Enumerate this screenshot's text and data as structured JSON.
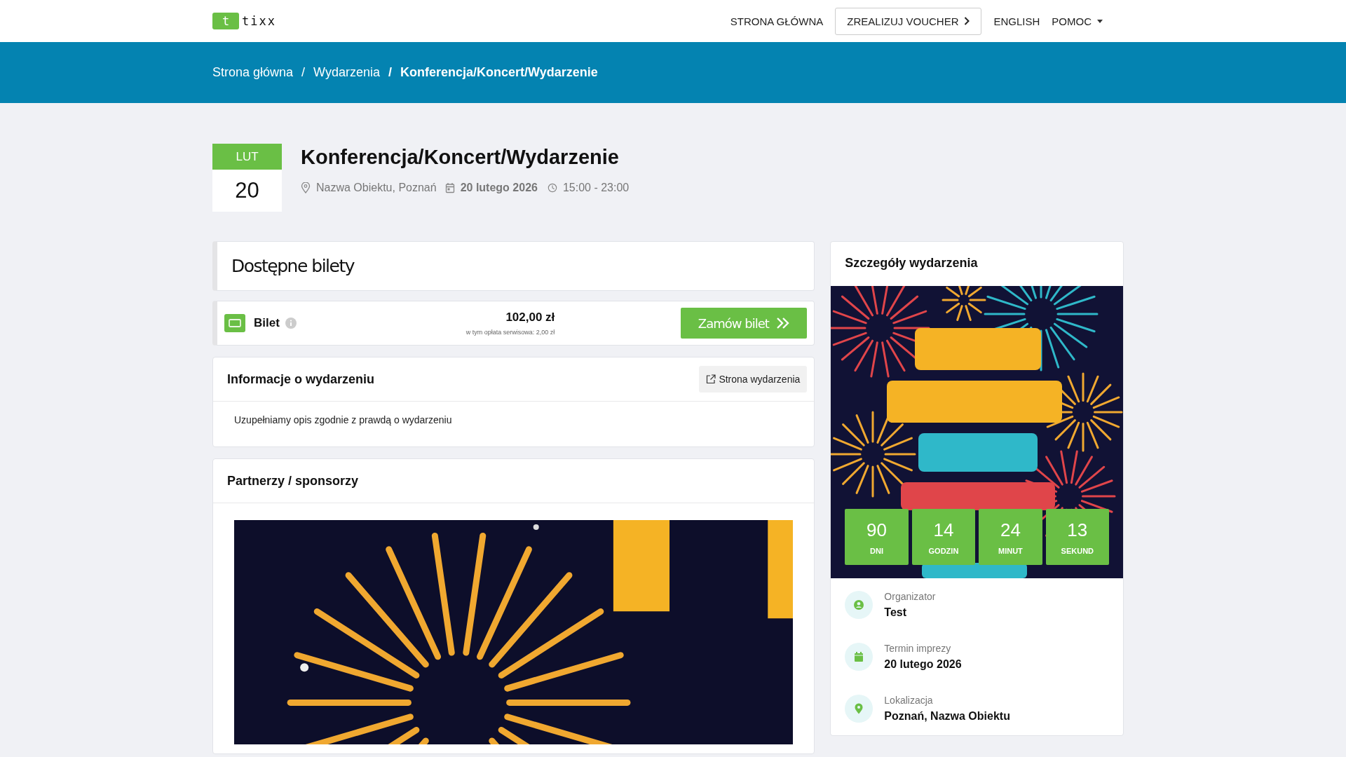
{
  "header": {
    "logo": {
      "mark": "t",
      "name": "tixx"
    },
    "nav": [
      {
        "label": "STRONA GŁÓWNA",
        "kind": "link"
      },
      {
        "label": "ZREALIZUJ VOUCHER",
        "kind": "outlined"
      },
      {
        "label": "ENGLISH",
        "kind": "link"
      },
      {
        "label": "POMOC",
        "kind": "dropdown"
      }
    ]
  },
  "breadcrumb": {
    "separator": "/",
    "items": [
      {
        "label": "Strona główna",
        "current": false
      },
      {
        "label": "Wydarzenia",
        "current": false
      },
      {
        "label": "Konferencja/Koncert/Wydarzenie",
        "current": true
      }
    ]
  },
  "event": {
    "month": "LUT",
    "day": "20",
    "title": "Konferencja/Koncert/Wydarzenie",
    "venue": "Nazwa Obiektu, Poznań",
    "date": "20 lutego 2026",
    "time": "15:00 - 23:00"
  },
  "tickets": {
    "title": "Dostępne bilety",
    "items": [
      {
        "name": "Bilet",
        "price": "102,00 zł",
        "fee_note": "w tym opłata serwisowa: 2,00 zł",
        "button": "Zamów bilet"
      }
    ]
  },
  "info": {
    "title": "Informacje o wydarzeniu",
    "link": "Strona wydarzenia",
    "description": "Uzupełniamy opis zgodnie z prawdą o wydarzeniu"
  },
  "partners": {
    "title": "Partnerzy / sponsorzy"
  },
  "details": {
    "title": "Szczegóły wydarzenia",
    "countdown": [
      {
        "value": "90",
        "unit": "DNI"
      },
      {
        "value": "14",
        "unit": "GODZIN"
      },
      {
        "value": "24",
        "unit": "MINUT"
      },
      {
        "value": "13",
        "unit": "SEKUND"
      }
    ],
    "facts": [
      {
        "kind": "organizer",
        "label": "Organizator",
        "value": "Test"
      },
      {
        "kind": "date",
        "label": "Termin imprezy",
        "value": "20 lutego 2026"
      },
      {
        "kind": "location",
        "label": "Lokalizacja",
        "value": "Poznań, Nazwa Obiektu"
      }
    ]
  }
}
